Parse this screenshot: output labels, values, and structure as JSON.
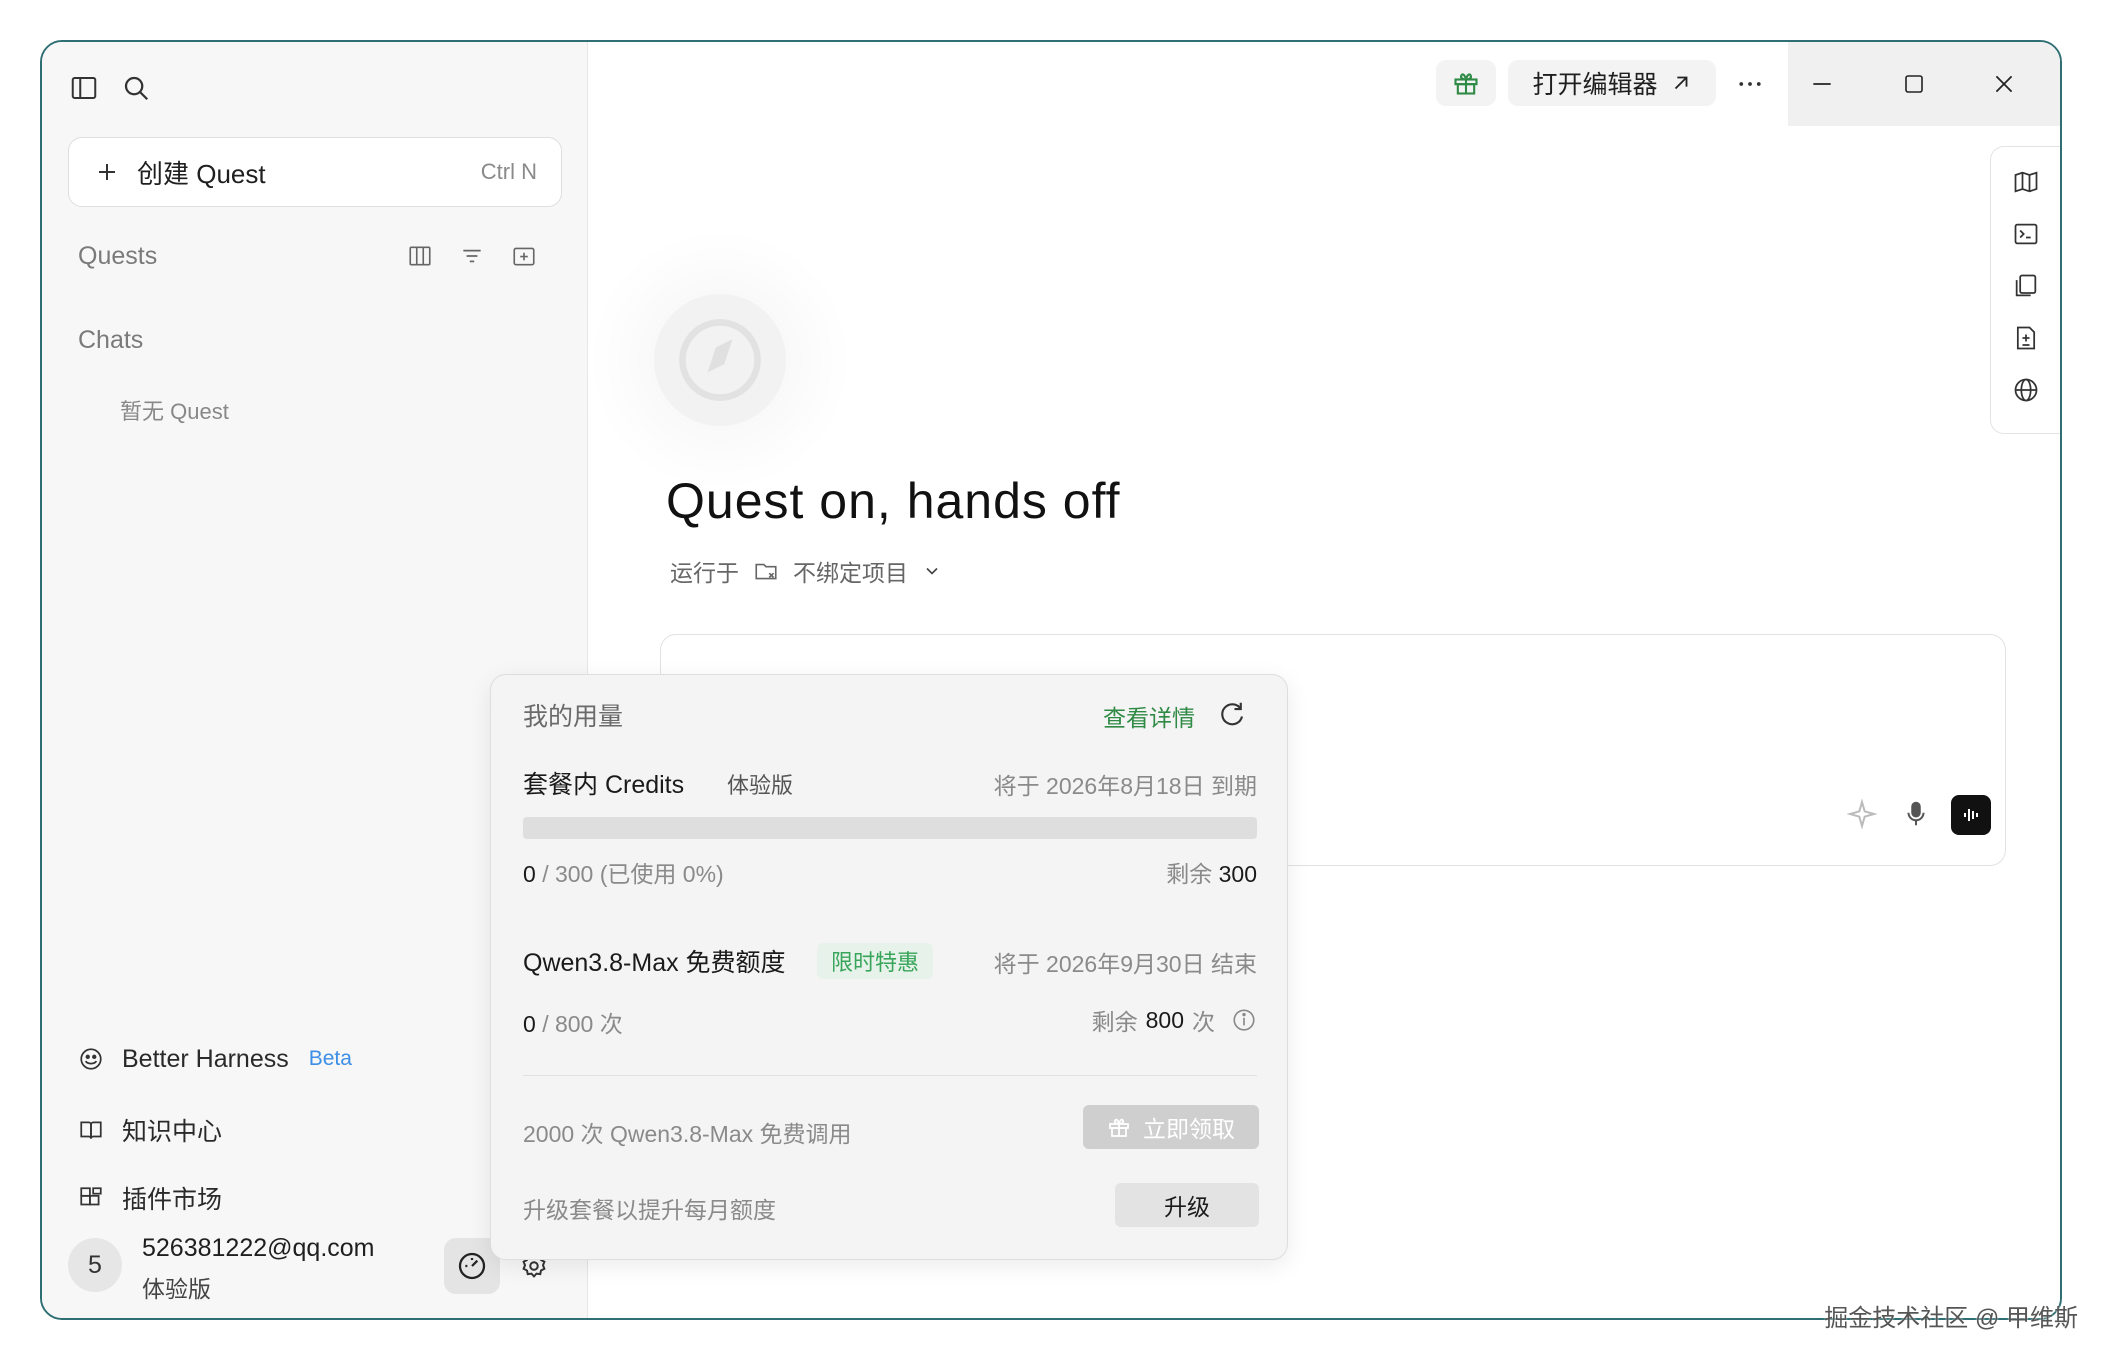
{
  "sidebar": {
    "create_label": "创建 Quest",
    "create_shortcut": "Ctrl N",
    "quests_title": "Quests",
    "chats_title": "Chats",
    "empty_quest": "暂无 Quest",
    "nav": [
      {
        "label": "Better Harness",
        "badge": "Beta",
        "icon": "harness-icon"
      },
      {
        "label": "知识中心",
        "icon": "book-icon"
      },
      {
        "label": "插件市场",
        "icon": "plugin-icon"
      }
    ],
    "user": {
      "avatar": "5",
      "email": "526381222@qq.com",
      "plan": "体验版"
    }
  },
  "topbar": {
    "editor_label": "打开编辑器"
  },
  "main": {
    "title": "Quest on, hands off",
    "runs_on": "运行于",
    "project": "不绑定项目"
  },
  "usage": {
    "title": "我的用量",
    "details_link": "查看详情",
    "credits": {
      "name": "套餐内 Credits",
      "tag": "体验版",
      "expiry": "将于 2026年8月18日 到期",
      "used": "0",
      "total": "/ 300 (已使用 0%)",
      "remaining_label": "剩余",
      "remaining": "300",
      "fraction_used": 0
    },
    "qwen": {
      "name": "Qwen3.8-Max 免费额度",
      "tag": "限时特惠",
      "expiry": "将于 2026年9月30日 结束",
      "used": "0",
      "total": "/ 800 次",
      "remaining_label": "剩余",
      "remaining": "800",
      "remaining_unit": "次"
    },
    "promo_text": "2000 次 Qwen3.8-Max 免费调用",
    "claim_label": "立即领取",
    "upgrade_text": "升级套餐以提升每月额度",
    "upgrade_label": "升级"
  },
  "watermark": "掘金技术社区 @ 甲维斯",
  "colors": {
    "accent_green": "#2f8a45",
    "beta_blue": "#3d8ee6",
    "window_border": "#2f6f73"
  }
}
